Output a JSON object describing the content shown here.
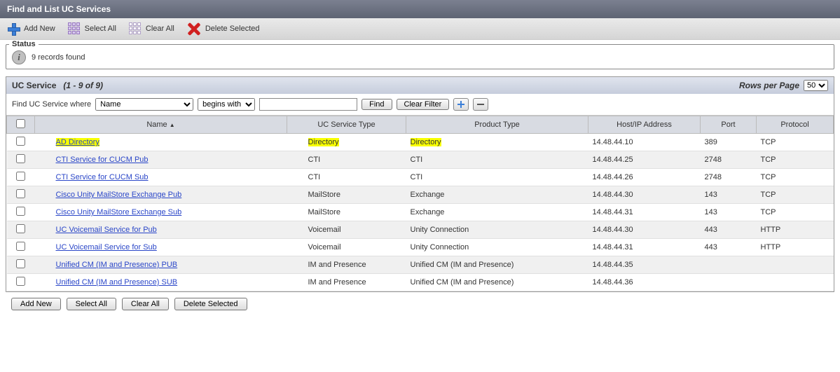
{
  "title": "Find and List UC Services",
  "toolbar": {
    "add_new": "Add New",
    "select_all": "Select All",
    "clear_all": "Clear All",
    "delete_selected": "Delete Selected"
  },
  "status": {
    "legend": "Status",
    "message": "9 records found"
  },
  "list": {
    "title": "UC Service",
    "range": "(1 - 9 of 9)",
    "rows_per_page_label": "Rows per Page",
    "rows_per_page_value": "50"
  },
  "search": {
    "prefix": "Find UC Service where",
    "field_options": [
      "Name"
    ],
    "field_selected": "Name",
    "op_options": [
      "begins with"
    ],
    "op_selected": "begins with",
    "value": "",
    "find": "Find",
    "clear_filter": "Clear Filter"
  },
  "columns": {
    "checkbox": "",
    "name": "Name",
    "service_type": "UC Service Type",
    "product_type": "Product Type",
    "host": "Host/IP Address",
    "port": "Port",
    "protocol": "Protocol"
  },
  "sort": {
    "column": "name",
    "dir": "asc"
  },
  "rows": [
    {
      "name": "AD Directory",
      "service_type": "Directory",
      "product_type": "Directory",
      "host": "14.48.44.10",
      "port": "389",
      "protocol": "TCP",
      "hl_name": true,
      "hl_st": true,
      "hl_pt": true
    },
    {
      "name": "CTI Service for CUCM Pub",
      "service_type": "CTI",
      "product_type": "CTI",
      "host": "14.48.44.25",
      "port": "2748",
      "protocol": "TCP"
    },
    {
      "name": "CTI Service for CUCM Sub",
      "service_type": "CTI",
      "product_type": "CTI",
      "host": "14.48.44.26",
      "port": "2748",
      "protocol": "TCP"
    },
    {
      "name": "Cisco Unity MailStore Exchange Pub",
      "service_type": "MailStore",
      "product_type": "Exchange",
      "host": "14.48.44.30",
      "port": "143",
      "protocol": "TCP"
    },
    {
      "name": "Cisco Unity MailStore Exchange Sub",
      "service_type": "MailStore",
      "product_type": "Exchange",
      "host": "14.48.44.31",
      "port": "143",
      "protocol": "TCP"
    },
    {
      "name": "UC Voicemail Service for Pub",
      "service_type": "Voicemail",
      "product_type": "Unity Connection",
      "host": "14.48.44.30",
      "port": "443",
      "protocol": "HTTP"
    },
    {
      "name": "UC Voicemail Service for Sub",
      "service_type": "Voicemail",
      "product_type": "Unity Connection",
      "host": "14.48.44.31",
      "port": "443",
      "protocol": "HTTP"
    },
    {
      "name": "Unified CM (IM and Presence) PUB",
      "service_type": "IM and Presence",
      "product_type": "Unified CM (IM and Presence)",
      "host": "14.48.44.35",
      "port": "",
      "protocol": ""
    },
    {
      "name": "Unified CM (IM and Presence) SUB",
      "service_type": "IM and Presence",
      "product_type": "Unified CM (IM and Presence)",
      "host": "14.48.44.36",
      "port": "",
      "protocol": ""
    }
  ],
  "footer": {
    "add_new": "Add New",
    "select_all": "Select All",
    "clear_all": "Clear All",
    "delete_selected": "Delete Selected"
  },
  "col_widths": {
    "chk": "40px",
    "name": "360px",
    "st": "170px",
    "pt": "260px",
    "host": "160px",
    "port": "80px",
    "proto": "100px"
  }
}
